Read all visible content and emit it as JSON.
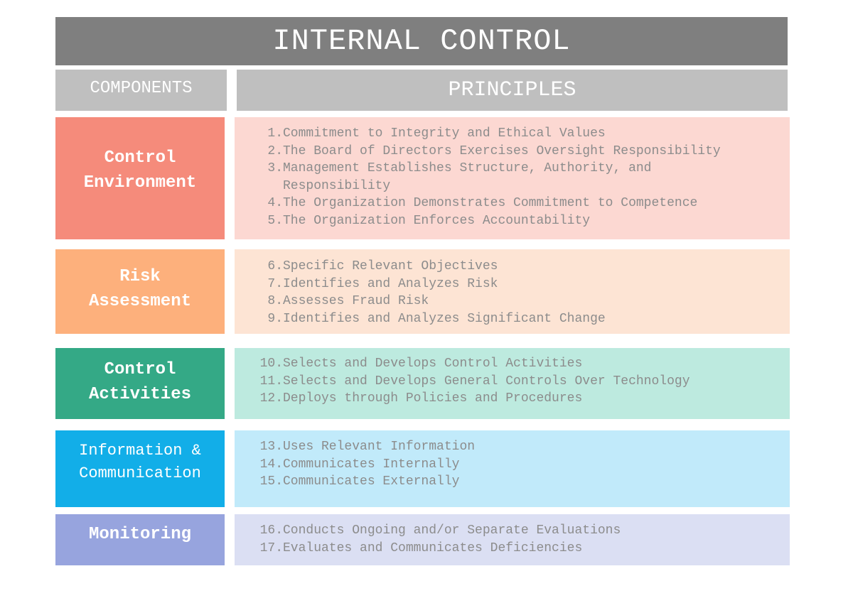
{
  "title": "INTERNAL CONTROL",
  "headers": {
    "components": "COMPONENTS",
    "principles": "PRINCIPLES"
  },
  "colors": {
    "title_bg": "#7f7f7f",
    "header_bg": "#bfbfbf",
    "principle_text": "#8c8c8c"
  },
  "rows": [
    {
      "component": "Control Environment",
      "component_lines": [
        "Control",
        "Environment"
      ],
      "color": "#f58b7b",
      "light_color": "#fcd8d2",
      "principles": [
        {
          "num": "1.",
          "text": "Commitment to Integrity and Ethical Values"
        },
        {
          "num": "2.",
          "text": "The Board of Directors Exercises Oversight Responsibility"
        },
        {
          "num": "3.",
          "text": "Management Establishes Structure, Authority, and Responsibility"
        },
        {
          "num": "4.",
          "text": "The Organization Demonstrates Commitment to Competence"
        },
        {
          "num": "5.",
          "text": "The Organization Enforces Accountability"
        }
      ]
    },
    {
      "component": "Risk Assessment",
      "component_lines": [
        "Risk",
        "Assessment"
      ],
      "color": "#fdb07c",
      "light_color": "#fde4d4",
      "principles": [
        {
          "num": "6.",
          "text": "Specific Relevant Objectives"
        },
        {
          "num": "7.",
          "text": "Identifies and Analyzes Risk"
        },
        {
          "num": "8.",
          "text": "Assesses Fraud Risk"
        },
        {
          "num": "9.",
          "text": "Identifies and Analyzes Significant Change"
        }
      ]
    },
    {
      "component": "Control Activities",
      "component_lines": [
        "Control",
        "Activities"
      ],
      "color": "#34a986",
      "light_color": "#bdeadf",
      "principles": [
        {
          "num": "10.",
          "text": "Selects and Develops Control Activities"
        },
        {
          "num": "11.",
          "text": "Selects and Develops General Controls Over Technology"
        },
        {
          "num": "12.",
          "text": "Deploys through Policies and Procedures"
        }
      ]
    },
    {
      "component": "Information & Communication",
      "component_lines": [
        "Information &",
        "Communication"
      ],
      "color": "#12aee8",
      "light_color": "#c1eafa",
      "principles": [
        {
          "num": "13.",
          "text": "Uses Relevant Information"
        },
        {
          "num": "14.",
          "text": "Communicates Internally"
        },
        {
          "num": "15.",
          "text": "Communicates Externally"
        }
      ]
    },
    {
      "component": "Monitoring",
      "component_lines": [
        "Monitoring"
      ],
      "color": "#97a4de",
      "light_color": "#dbdff3",
      "principles": [
        {
          "num": "16.",
          "text": "Conducts Ongoing and/or Separate Evaluations"
        },
        {
          "num": "17.",
          "text": "Evaluates and Communicates Deficiencies"
        }
      ]
    }
  ]
}
